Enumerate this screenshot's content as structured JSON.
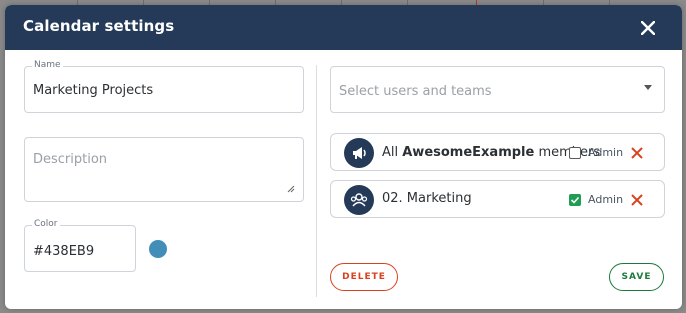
{
  "dialog": {
    "title": "Calendar settings"
  },
  "form": {
    "name": {
      "label": "Name",
      "value": "Marketing Projects"
    },
    "description": {
      "placeholder": "Description",
      "value": ""
    },
    "color": {
      "label": "Color",
      "value": "#438EB9",
      "swatch_hex": "#438EB9"
    }
  },
  "sharing": {
    "select_placeholder": "Select users and teams",
    "members": [
      {
        "name_prefix": "All ",
        "name_bold": "AwesomeExample",
        "name_suffix": " members",
        "admin_label": "Admin",
        "admin_checked": false,
        "icon": "megaphone-icon"
      },
      {
        "name_prefix": "02. Marketing",
        "name_bold": "",
        "name_suffix": "",
        "admin_label": "Admin",
        "admin_checked": true,
        "icon": "team-icon"
      }
    ]
  },
  "actions": {
    "delete_label": "DELETE",
    "save_label": "SAVE"
  },
  "colors": {
    "header_bg": "#243a58",
    "delete": "#d9421f",
    "save": "#1b7a3c",
    "checkbox_checked": "#1f9d55",
    "remove_x": "#d9421f"
  }
}
